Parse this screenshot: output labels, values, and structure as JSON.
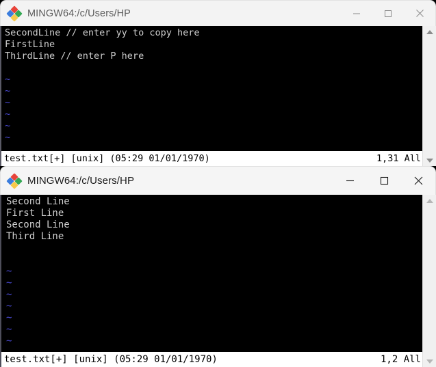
{
  "windows": [
    {
      "id": "window-1",
      "title": "MINGW64:/c/Users/HP",
      "icon": "mingw64-icon",
      "active": false,
      "controls": {
        "minimize": "—",
        "maximize": "□",
        "close": "✕"
      },
      "terminal": {
        "lines": [
          {
            "text": "SecondLine // enter yy to copy here",
            "kind": "text"
          },
          {
            "text": "FirstLine",
            "kind": "text"
          },
          {
            "text": "ThirdLine // enter P here",
            "kind": "text"
          },
          {
            "text": "",
            "kind": "blank"
          },
          {
            "text": "~",
            "kind": "tilde"
          },
          {
            "text": "~",
            "kind": "tilde"
          },
          {
            "text": "~",
            "kind": "tilde"
          },
          {
            "text": "~",
            "kind": "tilde"
          },
          {
            "text": "~",
            "kind": "tilde"
          },
          {
            "text": "~",
            "kind": "tilde"
          }
        ],
        "status_left": "test.txt[+] [unix] (05:29 01/01/1970)",
        "status_right": "1,31 All"
      },
      "scrollbar": {
        "up": "scroll-up-arrow",
        "down": "scroll-down-arrow"
      }
    },
    {
      "id": "window-2",
      "title": "MINGW64:/c/Users/HP",
      "icon": "mingw64-icon",
      "active": true,
      "controls": {
        "minimize": "—",
        "maximize": "□",
        "close": "✕"
      },
      "terminal": {
        "lines": [
          {
            "text": "Second Line",
            "kind": "text"
          },
          {
            "text": "First Line",
            "kind": "text"
          },
          {
            "text": "Second Line",
            "kind": "text"
          },
          {
            "text": "Third Line",
            "kind": "text"
          },
          {
            "text": "",
            "kind": "blank"
          },
          {
            "text": "",
            "kind": "blank"
          },
          {
            "text": "~",
            "kind": "tilde"
          },
          {
            "text": "~",
            "kind": "tilde"
          },
          {
            "text": "~",
            "kind": "tilde"
          },
          {
            "text": "~",
            "kind": "tilde"
          },
          {
            "text": "~",
            "kind": "tilde"
          },
          {
            "text": "~",
            "kind": "tilde"
          },
          {
            "text": "~",
            "kind": "tilde"
          }
        ],
        "status_left": "test.txt[+] [unix] (05:29 01/01/1970)",
        "status_right": "1,2 All"
      },
      "scrollbar": {
        "up": "scroll-up-arrow",
        "down": "scroll-down-arrow"
      }
    }
  ],
  "colors": {
    "terminal_background": "#000000",
    "terminal_foreground": "#cfcfcf",
    "tilde": "#4a4ad6",
    "status_background": "#ffffff",
    "status_foreground": "#000000",
    "titlebar_background": "#f3f3f3",
    "icon_red": "#e8443a",
    "icon_blue": "#3b7ddd",
    "icon_green": "#34a853",
    "icon_yellow": "#f7c948"
  }
}
